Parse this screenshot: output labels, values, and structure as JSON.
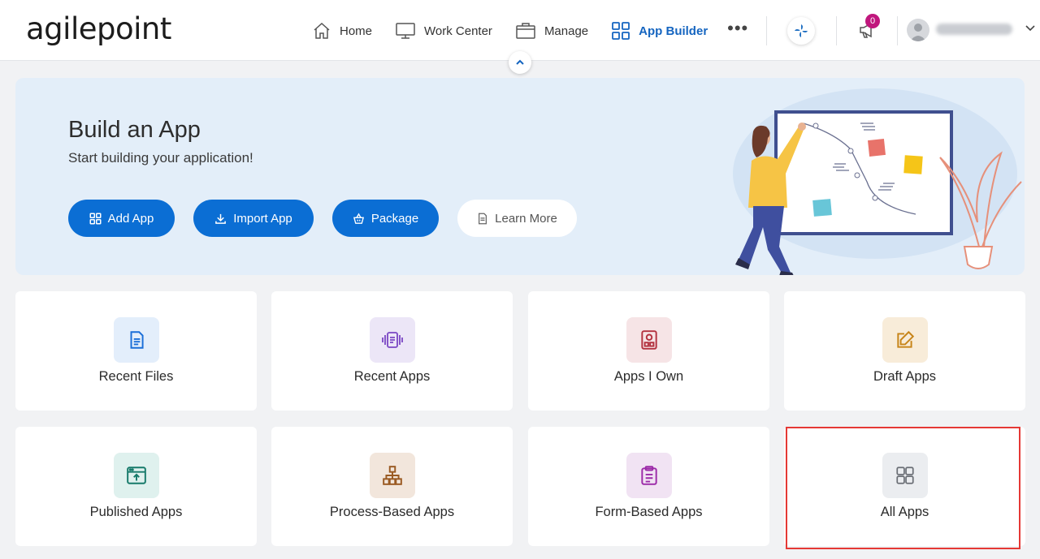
{
  "brand": {
    "logo_text": "agilepoint"
  },
  "nav": {
    "items": [
      {
        "label": "Home",
        "icon": "home-icon",
        "active": false
      },
      {
        "label": "Work Center",
        "icon": "monitor-icon",
        "active": false
      },
      {
        "label": "Manage",
        "icon": "briefcase-icon",
        "active": false
      },
      {
        "label": "App Builder",
        "icon": "grid-icon",
        "active": true
      }
    ],
    "more_label": "•••",
    "notifications_count": "0"
  },
  "banner": {
    "title": "Build an App",
    "subtitle": "Start building your application!",
    "buttons": [
      {
        "label": "Add App",
        "icon": "grid-icon"
      },
      {
        "label": "Import App",
        "icon": "download-icon"
      },
      {
        "label": "Package",
        "icon": "basket-icon"
      },
      {
        "label": "Learn More",
        "icon": "document-icon"
      }
    ]
  },
  "cards": [
    {
      "label": "Recent Files",
      "icon": "file-icon"
    },
    {
      "label": "Recent Apps",
      "icon": "app-frame-icon"
    },
    {
      "label": "Apps I Own",
      "icon": "owner-badge-icon"
    },
    {
      "label": "Draft Apps",
      "icon": "edit-icon"
    },
    {
      "label": "Published Apps",
      "icon": "publish-icon"
    },
    {
      "label": "Process-Based Apps",
      "icon": "hierarchy-icon"
    },
    {
      "label": "Form-Based Apps",
      "icon": "clipboard-icon"
    },
    {
      "label": "All Apps",
      "icon": "grid-icon"
    }
  ],
  "colors": {
    "primary": "#0b6ed4",
    "highlight": "#e53935",
    "badge": "#c0177d"
  }
}
